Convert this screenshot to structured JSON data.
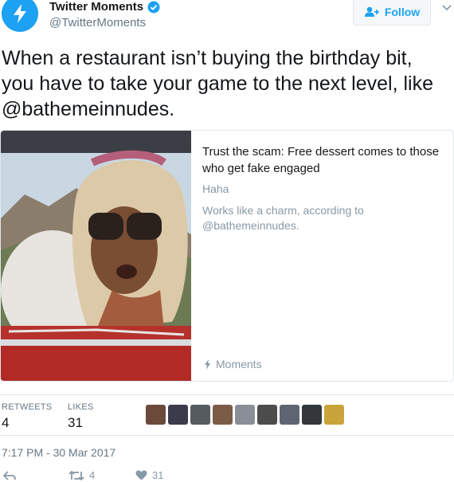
{
  "author": {
    "display_name": "Twitter Moments",
    "handle": "@TwitterMoments",
    "avatar_icon": "lightning-bolt-icon",
    "verified_icon": "verified-badge-icon"
  },
  "follow": {
    "label": "Follow",
    "icon": "add-person-icon"
  },
  "menu": {
    "icon": "chevron-down-icon"
  },
  "tweet": {
    "text": "When a restaurant isn’t buying the birthday bit, you have to take your game to the next level, like @bathemeinnudes."
  },
  "card": {
    "image_icon": "photo-woman-in-headscarf-sunglasses",
    "title": "Trust the scam: Free dessert comes to those who get fake engaged",
    "line1": "Haha",
    "line2": "Works like a charm, according to @bathemeinnudes.",
    "footer_label": "Moments",
    "footer_icon": "lightning-bolt-icon"
  },
  "stats": {
    "retweets_label": "RETWEETS",
    "retweets_value": "4",
    "likes_label": "LIKES",
    "likes_value": "31",
    "liker_count_shown": 9
  },
  "timestamp": "7:17 PM - 30 Mar 2017",
  "actions": {
    "reply_icon": "reply-icon",
    "retweet_icon": "retweet-icon",
    "retweet_count": "4",
    "like_icon": "heart-icon",
    "like_count": "31"
  },
  "colors": {
    "brand": "#1da1f2",
    "text": "#14171a",
    "secondary": "#657786",
    "border": "#e1e8ed"
  }
}
